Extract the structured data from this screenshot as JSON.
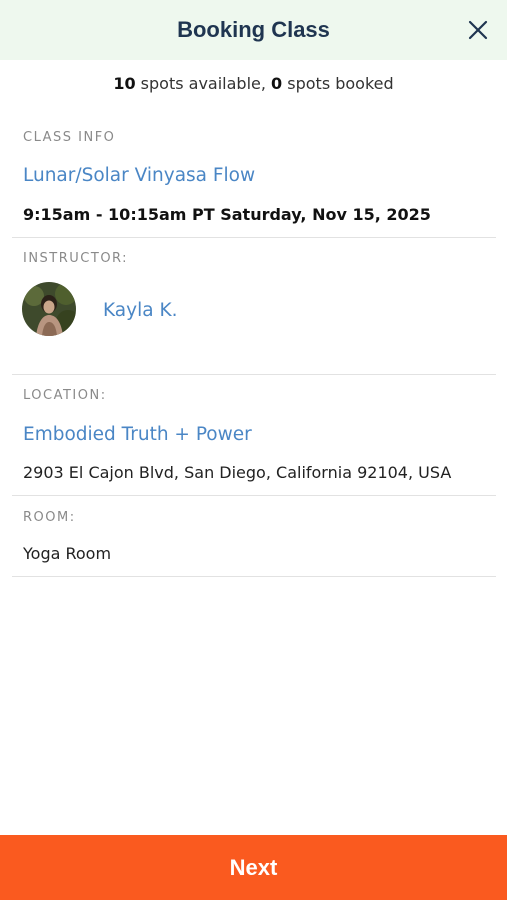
{
  "header": {
    "title": "Booking Class",
    "close_icon": "close-icon"
  },
  "spots": {
    "available_count": "10",
    "available_text": " spots available, ",
    "booked_count": "0",
    "booked_text": " spots booked"
  },
  "class_info": {
    "label": "CLASS INFO",
    "name": "Lunar/Solar Vinyasa Flow",
    "datetime": "9:15am - 10:15am PT Saturday, Nov 15, 2025"
  },
  "instructor": {
    "label": "INSTRUCTOR:",
    "name": "Kayla K."
  },
  "location": {
    "label": "LOCATION:",
    "name": "Embodied Truth + Power",
    "address": "2903 El Cajon Blvd, San Diego, California 92104, USA"
  },
  "room": {
    "label": "ROOM:",
    "name": "Yoga Room"
  },
  "footer": {
    "next_label": "Next"
  },
  "colors": {
    "header_bg": "#eef8ee",
    "title": "#1f3550",
    "link": "#4a86c5",
    "accent": "#fa5a1f"
  }
}
